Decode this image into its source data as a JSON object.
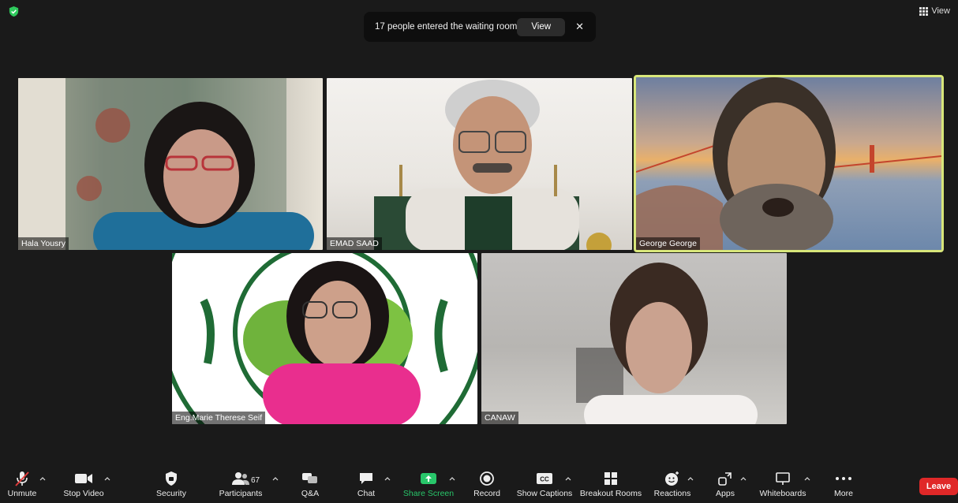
{
  "header": {
    "view_label": "View"
  },
  "notification": {
    "message": "17 people entered the waiting room",
    "view_label": "View",
    "close_glyph": "✕"
  },
  "participants": [
    {
      "name": "Hala Yousry"
    },
    {
      "name": "EMAD SAAD"
    },
    {
      "name": "George George",
      "active_speaker": true
    },
    {
      "name": "Eng.Marie Therese Seif"
    },
    {
      "name": "CANAW"
    }
  ],
  "toolbar": {
    "unmute": "Unmute",
    "stop_video": "Stop Video",
    "security": "Security",
    "participants": "Participants",
    "participant_count": "67",
    "qa": "Q&A",
    "chat": "Chat",
    "share_screen": "Share Screen",
    "record": "Record",
    "show_captions": "Show Captions",
    "captions_icon_text": "CC",
    "breakout_rooms": "Breakout Rooms",
    "reactions": "Reactions",
    "apps": "Apps",
    "whiteboards": "Whiteboards",
    "more": "More",
    "leave": "Leave"
  },
  "colors": {
    "background": "#1a1a1a",
    "active_speaker_border": "#d8e67a",
    "share_green": "#28c66a",
    "leave_red": "#e02828",
    "security_shield": "#2ec95c"
  }
}
